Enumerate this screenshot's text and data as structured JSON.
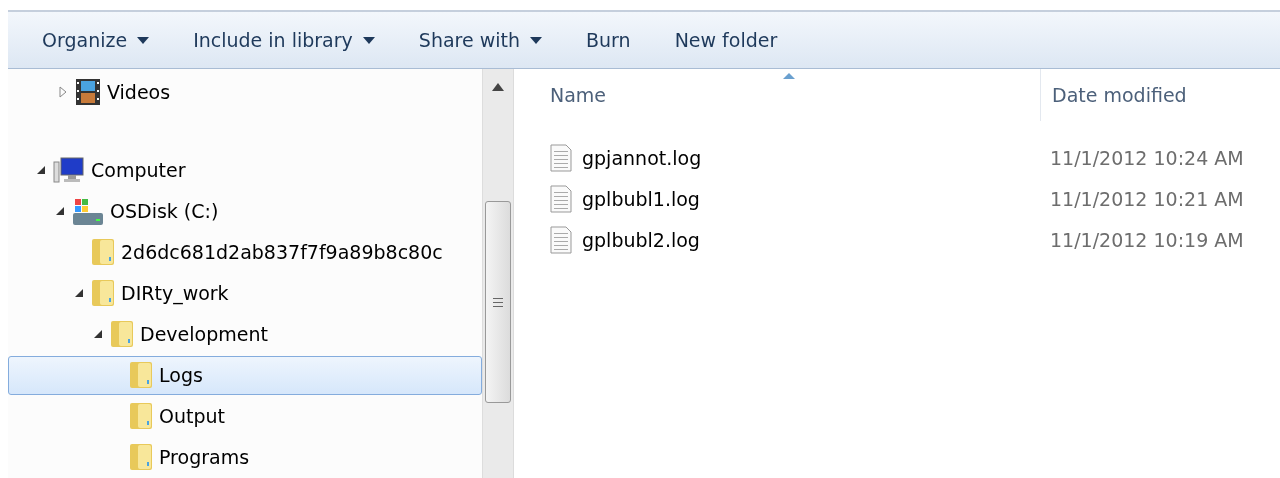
{
  "toolbar": [
    {
      "label": "Organize",
      "dropdown": true
    },
    {
      "label": "Include in library",
      "dropdown": true
    },
    {
      "label": "Share with",
      "dropdown": true
    },
    {
      "label": "Burn",
      "dropdown": false
    },
    {
      "label": "New folder",
      "dropdown": false
    }
  ],
  "navigation_tree": [
    {
      "label": "Videos",
      "kind": "videos",
      "expanded": false,
      "selected": false
    },
    {
      "label": "Computer",
      "kind": "computer",
      "expanded": true,
      "selected": false,
      "children": [
        {
          "label": "OSDisk (C:)",
          "kind": "drive",
          "expanded": true,
          "selected": false,
          "children": [
            {
              "label": "2d6dc681d2ab837f7f9a89b8c80c",
              "kind": "folder",
              "selected": false
            },
            {
              "label": "DIRty_work",
              "kind": "folder",
              "expanded": true,
              "selected": false,
              "children": [
                {
                  "label": "Development",
                  "kind": "folder",
                  "expanded": true,
                  "selected": false,
                  "children": [
                    {
                      "label": "Logs",
                      "kind": "folder",
                      "selected": true
                    },
                    {
                      "label": "Output",
                      "kind": "folder",
                      "selected": false
                    },
                    {
                      "label": "Programs",
                      "kind": "folder",
                      "selected": false
                    }
                  ]
                }
              ]
            }
          ]
        }
      ]
    }
  ],
  "file_list": {
    "columns": [
      "Name",
      "Date modified"
    ],
    "rows": [
      {
        "name": "gpjannot.log",
        "date_modified": "11/1/2012 10:24 AM"
      },
      {
        "name": "gplbubl1.log",
        "date_modified": "11/1/2012 10:21 AM"
      },
      {
        "name": "gplbubl2.log",
        "date_modified": "11/1/2012 10:19 AM"
      }
    ]
  }
}
